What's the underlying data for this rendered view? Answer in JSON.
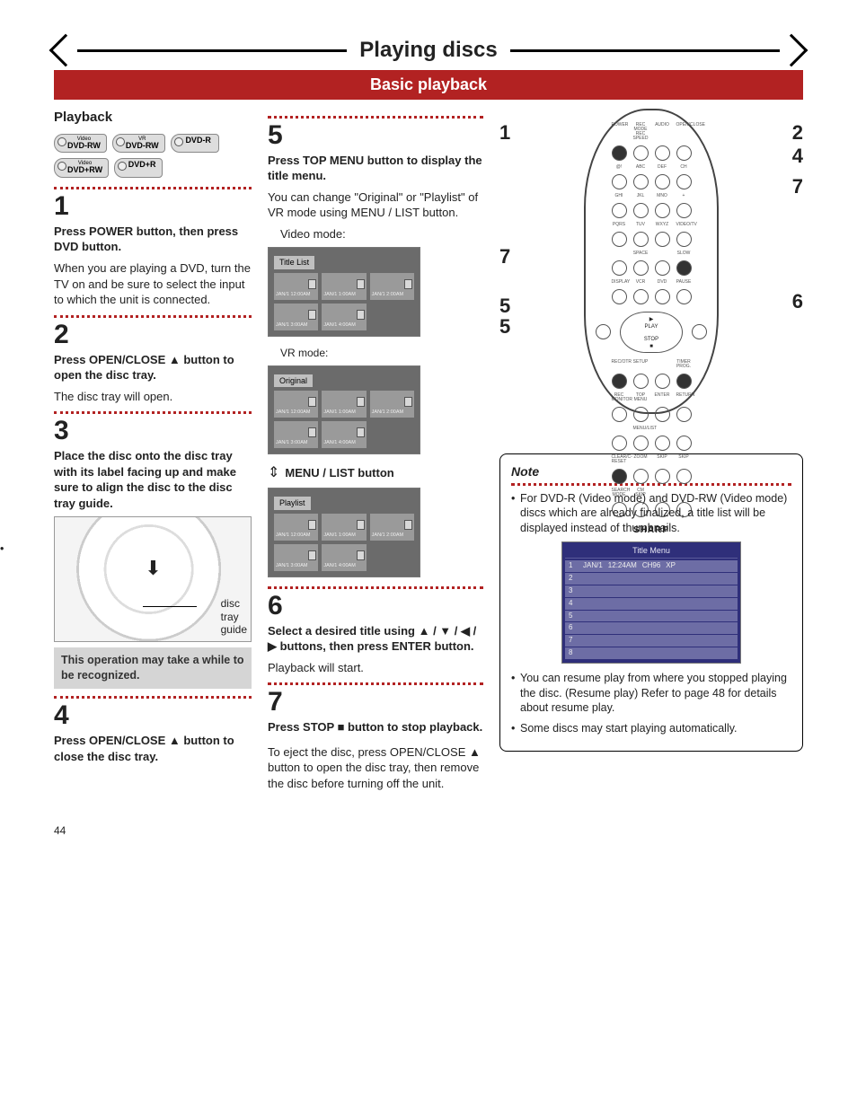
{
  "page_title": "Playing discs",
  "subtitle_bar": "Basic playback",
  "section_heading": "Playback",
  "page_number": "44",
  "badges": [
    {
      "sup": "Video",
      "main": "DVD-RW"
    },
    {
      "sup": "VR",
      "main": "DVD-RW"
    },
    {
      "sup": "",
      "main": "DVD-R"
    },
    {
      "sup": "Video",
      "main": "DVD+RW"
    },
    {
      "sup": "",
      "main": "DVD+R"
    }
  ],
  "left": {
    "s1": {
      "num": "1",
      "bold": "Press POWER button, then press DVD button.",
      "body": "When you are playing a DVD, turn the TV on and be sure to select the input to which the unit is connected."
    },
    "s2": {
      "num": "2",
      "bold": "Press OPEN/CLOSE ▲ button to open the disc tray.",
      "body": "The disc tray will open."
    },
    "s3": {
      "num": "3",
      "bold": "Place the disc onto the disc tray with its label facing up and make sure to align the disc to the disc tray guide."
    },
    "tray_label": "disc\ntray\nguide",
    "greynote": "This operation may take a while to be recognized.",
    "s4": {
      "num": "4",
      "bold": "Press OPEN/CLOSE ▲ button to close the disc tray."
    }
  },
  "center": {
    "s5": {
      "num": "5",
      "bold": "Press TOP MENU button to display the title menu.",
      "body": "You can change \"Original\" or \"Playlist\" of VR mode using MENU / LIST button.",
      "indent": "Video mode:"
    },
    "video_tab": "Title List",
    "vr_label": "VR mode:",
    "vr_tab": "Original",
    "menulist": "MENU / LIST button",
    "playlist_tab": "Playlist",
    "thumbs": [
      "JAN/1   12:00AM",
      "JAN/1   1:00AM",
      "JAN/1   2:00AM",
      "JAN/1   3:00AM",
      "JAN/1   4:00AM"
    ],
    "s6": {
      "num": "6",
      "bold": "Select a desired title using ▲ / ▼ / ◀ / ▶ buttons, then press ENTER button.",
      "body": "Playback will start."
    },
    "s7": {
      "num": "7",
      "bold": "Press STOP ■ button to stop playback.",
      "body": "To eject the disc, press OPEN/CLOSE ▲ button to open the disc tray, then remove the disc before turning off the unit."
    }
  },
  "remote": {
    "row_labels": [
      [
        "POWER",
        "REC MODE\nREC SPEED",
        "AUDIO",
        "OPEN/CLOSE"
      ],
      [
        "@!",
        "ABC",
        "DEF",
        "CH"
      ],
      [
        "GHI",
        "JKL",
        "MNO",
        "+"
      ],
      [
        "PQRS",
        "TUV",
        "WXYZ",
        "VIDEO/TV"
      ],
      [
        "",
        "SPACE",
        "",
        "SLOW"
      ],
      [
        "DISPLAY",
        "VCR",
        "DVD",
        "PAUSE"
      ]
    ],
    "nav_center": "PLAY",
    "nav_bottom": "STOP",
    "mid_rows": [
      [
        "REC/OTR",
        "SETUP",
        "",
        "TIMER PROG."
      ],
      [
        "REC MONITOR",
        "TOP MENU",
        "ENTER",
        "RETURN"
      ],
      [
        "",
        "MENU/LIST",
        "",
        ""
      ],
      [
        "CLEAR/C-RESET",
        "ZOOM",
        "SKIP",
        "SKIP"
      ],
      [
        "SEARCH\nMODE",
        "CM SKIP",
        "",
        ""
      ]
    ],
    "brand": "SHARP",
    "callouts_left": {
      "1": "1",
      "7a": "7",
      "5a": "5",
      "5b": "5"
    },
    "callouts_right": {
      "2": "2",
      "4": "4",
      "7b": "7",
      "6": "6"
    }
  },
  "note": {
    "heading": "Note",
    "items": [
      "For DVD-R (Video mode) and DVD-RW (Video mode) discs which are already finalized, a title list will be displayed instead of thumbnails.",
      "You can resume play from where you stopped playing the disc. (Resume play) Refer to page 48 for details about resume play.",
      "Some discs may start playing automatically."
    ],
    "titlemenu_header": "Title Menu",
    "titlemenu_rows": [
      [
        "1",
        "JAN/1",
        "12:24AM",
        "CH96",
        "XP"
      ],
      [
        "2",
        "",
        "",
        "",
        ""
      ],
      [
        "3",
        "",
        "",
        "",
        ""
      ],
      [
        "4",
        "",
        "",
        "",
        ""
      ],
      [
        "5",
        "",
        "",
        "",
        ""
      ],
      [
        "6",
        "",
        "",
        "",
        ""
      ],
      [
        "7",
        "",
        "",
        "",
        ""
      ],
      [
        "8",
        "",
        "",
        "",
        ""
      ]
    ]
  }
}
